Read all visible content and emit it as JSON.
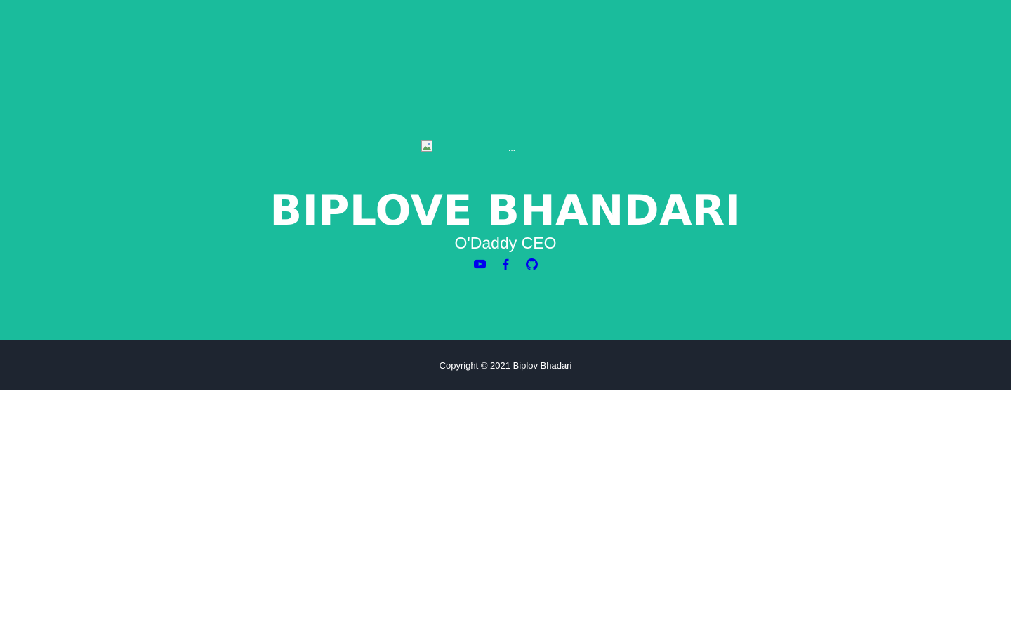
{
  "masthead": {
    "avatar_alt": "...",
    "name": "BIPLOVE BHANDARI",
    "tagline": "O'Daddy CEO",
    "social": [
      {
        "icon": "youtube-icon",
        "color": "#0000ee"
      },
      {
        "icon": "facebook-icon",
        "color": "#0000ee"
      },
      {
        "icon": "github-icon",
        "color": "#0000ee"
      }
    ],
    "background_color": "#1abc9c"
  },
  "footer": {
    "copyright": "Copyright © 2021 Biplov Bhadari",
    "background_color": "#1e2530"
  }
}
